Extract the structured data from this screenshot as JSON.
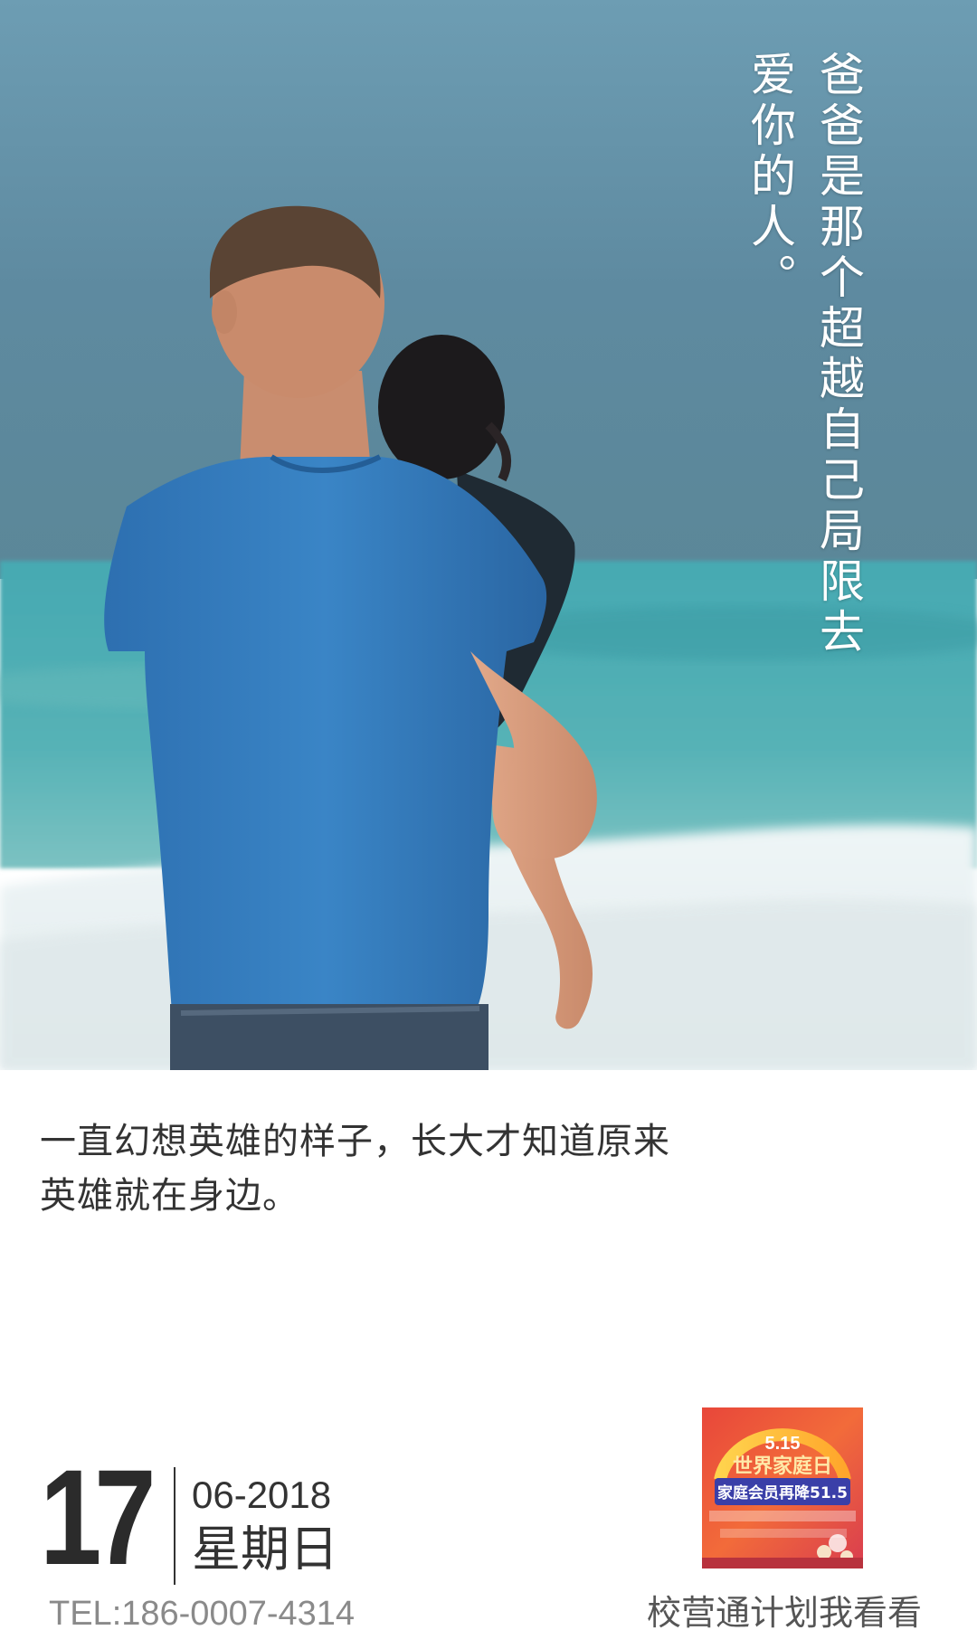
{
  "hero": {
    "quote_lines": [
      "爸爸是那个超越自己局限去",
      "爱你的人。"
    ]
  },
  "caption": {
    "lines": [
      "一直幻想英雄的样子，长大才知道原来",
      "英雄就在身边。"
    ]
  },
  "date": {
    "day": "17",
    "month_year": "06-2018",
    "weekday": "星期日"
  },
  "contact": {
    "tel": "TEL:186-0007-4314"
  },
  "promo": {
    "title_small": "5.15",
    "title_main": "世界家庭日",
    "subtitle": "家庭会员再降51.5",
    "caption": "校营通计划我看看"
  },
  "colors": {
    "sky_top": "#5f8ea6",
    "sea": "#3fa7ad",
    "shirt": "#2f77b8",
    "text_dark": "#333333",
    "text_gray": "#8a8a8a"
  }
}
